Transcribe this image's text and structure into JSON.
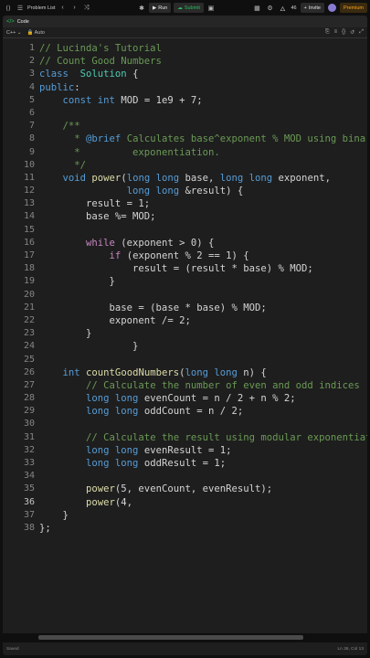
{
  "topbar": {
    "problem_list": "Problem List",
    "run": "Run",
    "submit": "Submit",
    "streak": "46",
    "invite": "Invite",
    "premium": "Premium"
  },
  "panel": {
    "title": "Code"
  },
  "toolbar": {
    "language": "C++",
    "mode": "Auto"
  },
  "editor": {
    "active_line": 36,
    "lines": [
      [
        [
          "cm",
          "// Lucinda's Tutorial"
        ]
      ],
      [
        [
          "cm",
          "// Count Good Numbers"
        ]
      ],
      [
        [
          "kw",
          "class"
        ],
        [
          "",
          "  "
        ],
        [
          "ty",
          "Solution"
        ],
        [
          "",
          " {"
        ]
      ],
      [
        [
          "kw",
          "public"
        ],
        [
          "",
          ":"
        ]
      ],
      [
        [
          "",
          "    "
        ],
        [
          "kw",
          "const"
        ],
        [
          "",
          " "
        ],
        [
          "kw",
          "int"
        ],
        [
          "",
          " MOD = 1e9 + 7;"
        ]
      ],
      [
        [
          "",
          ""
        ]
      ],
      [
        [
          "",
          "    "
        ],
        [
          "cm",
          "/**"
        ]
      ],
      [
        [
          "",
          "    "
        ],
        [
          "cm",
          "  * "
        ],
        [
          "doc",
          "@brief"
        ],
        [
          "cm",
          " Calculates base^exponent % MOD using binary"
        ]
      ],
      [
        [
          "",
          "    "
        ],
        [
          "cm",
          "  *         exponentiation."
        ]
      ],
      [
        [
          "",
          "    "
        ],
        [
          "cm",
          "  */"
        ]
      ],
      [
        [
          "",
          "    "
        ],
        [
          "kw",
          "void"
        ],
        [
          "",
          " "
        ],
        [
          "fn",
          "power"
        ],
        [
          "",
          "("
        ],
        [
          "kw",
          "long long"
        ],
        [
          "",
          " base, "
        ],
        [
          "kw",
          "long long"
        ],
        [
          "",
          " exponent,"
        ]
      ],
      [
        [
          "",
          "               "
        ],
        [
          "kw",
          "long long"
        ],
        [
          "",
          " &result) {"
        ]
      ],
      [
        [
          "",
          "        result = 1;"
        ]
      ],
      [
        [
          "",
          "        base %= MOD;"
        ]
      ],
      [
        [
          "",
          ""
        ]
      ],
      [
        [
          "",
          "        "
        ],
        [
          "ctl",
          "while"
        ],
        [
          "",
          " (exponent > 0) {"
        ]
      ],
      [
        [
          "",
          "            "
        ],
        [
          "ctl",
          "if"
        ],
        [
          "",
          " (exponent % 2 == 1) {"
        ]
      ],
      [
        [
          "",
          "                result = (result * base) % MOD;"
        ]
      ],
      [
        [
          "",
          "            }"
        ]
      ],
      [
        [
          "",
          ""
        ]
      ],
      [
        [
          "",
          "            base = (base * base) % MOD;"
        ]
      ],
      [
        [
          "",
          "            exponent /= 2;"
        ]
      ],
      [
        [
          "",
          "        }"
        ]
      ],
      [
        [
          "",
          "                }"
        ]
      ],
      [
        [
          "",
          ""
        ]
      ],
      [
        [
          "",
          "    "
        ],
        [
          "kw",
          "int"
        ],
        [
          "",
          " "
        ],
        [
          "fn",
          "countGoodNumbers"
        ],
        [
          "",
          "("
        ],
        [
          "kw",
          "long long"
        ],
        [
          "",
          " n) {"
        ]
      ],
      [
        [
          "",
          "        "
        ],
        [
          "cm",
          "// Calculate the number of even and odd indices"
        ]
      ],
      [
        [
          "",
          "        "
        ],
        [
          "kw",
          "long long"
        ],
        [
          "",
          " evenCount = n / 2 + n % 2;"
        ]
      ],
      [
        [
          "",
          "        "
        ],
        [
          "kw",
          "long long"
        ],
        [
          "",
          " oddCount = n / 2;"
        ]
      ],
      [
        [
          "",
          ""
        ]
      ],
      [
        [
          "",
          "        "
        ],
        [
          "cm",
          "// Calculate the result using modular exponentiation"
        ]
      ],
      [
        [
          "",
          "        "
        ],
        [
          "kw",
          "long long"
        ],
        [
          "",
          " evenResult = 1;"
        ]
      ],
      [
        [
          "",
          "        "
        ],
        [
          "kw",
          "long long"
        ],
        [
          "",
          " oddResult = 1;"
        ]
      ],
      [
        [
          "",
          ""
        ]
      ],
      [
        [
          "",
          "        "
        ],
        [
          "fn",
          "power"
        ],
        [
          "",
          "(5, evenCount, evenResult);"
        ]
      ],
      [
        [
          "",
          "        "
        ],
        [
          "fn",
          "power"
        ],
        [
          "",
          "(4,"
        ]
      ],
      [
        [
          "",
          "    }"
        ]
      ],
      [
        [
          "",
          "};"
        ]
      ]
    ]
  },
  "status": {
    "left": "Saved",
    "right": "Ln 36, Col 13"
  },
  "colors": {
    "accent_green": "#2cbb5d",
    "premium_orange": "#ffa116",
    "editor_bg": "#1e1e1e"
  }
}
